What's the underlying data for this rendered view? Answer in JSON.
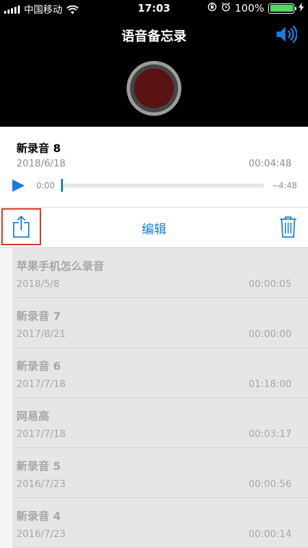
{
  "status_bar": {
    "carrier": "中国移动",
    "time": "17:03",
    "battery": "100%",
    "battery_color": "#4cd964"
  },
  "header": {
    "title": "语音备忘录",
    "speaker_icon": "speaker-icon",
    "record_icon": "record-button"
  },
  "current_recording": {
    "name": "新录音 8",
    "date": "2018/6/18",
    "duration": "00:04:48",
    "elapsed": "0:00",
    "remaining": "−4:48",
    "progress": 0
  },
  "toolbar": {
    "share_icon": "share-icon",
    "edit_label": "编辑",
    "trash_icon": "trash-icon"
  },
  "recordings": [
    {
      "name": "苹果手机怎么录音",
      "date": "2018/5/8",
      "duration": "00:00:05"
    },
    {
      "name": "新录音 7",
      "date": "2017/8/21",
      "duration": "00:00:00"
    },
    {
      "name": "新录音 6",
      "date": "2017/7/18",
      "duration": "01:18:00"
    },
    {
      "name": "网易高",
      "date": "2017/7/18",
      "duration": "00:03:17"
    },
    {
      "name": "新录音 5",
      "date": "2016/7/23",
      "duration": "00:00:56"
    },
    {
      "name": "新录音 4",
      "date": "2016/7/23",
      "duration": "00:00:14"
    }
  ],
  "colors": {
    "accent": "#1a7cde",
    "highlight_border": "#d6322b",
    "record": "#5a1212"
  }
}
